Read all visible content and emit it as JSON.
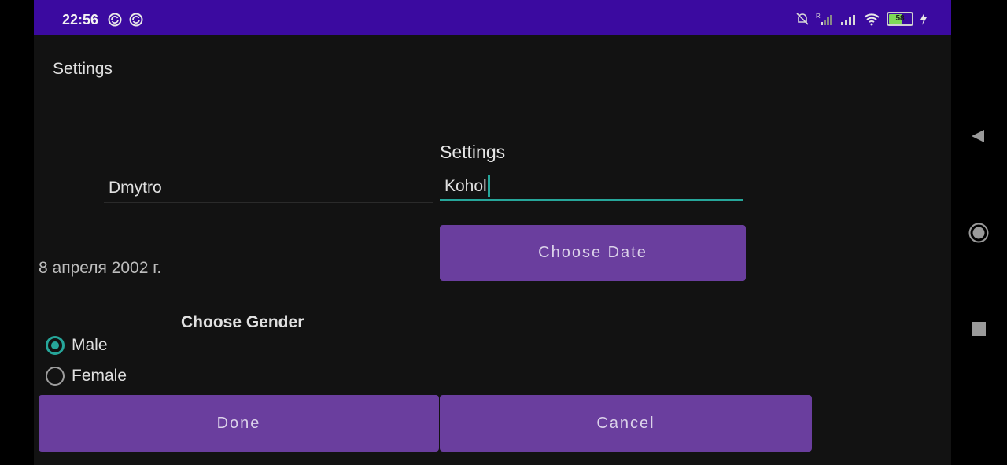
{
  "status_bar": {
    "time": "22:56",
    "battery_level": "58",
    "background_color": "#3b0aa0",
    "icons": [
      "sync-icon",
      "sync-icon",
      "mute-icon",
      "signal-roaming-icon",
      "signal-icon",
      "wifi-icon",
      "battery-icon",
      "charging-icon"
    ]
  },
  "app_bar": {
    "title": "Settings"
  },
  "form": {
    "section_title": "Settings",
    "first_name_value": "Dmytro",
    "last_name_value": "Kohol",
    "choose_date_label": "Choose Date",
    "date_value": "8 апреля 2002 г.",
    "gender_title": "Choose Gender",
    "gender_options": [
      {
        "label": "Male",
        "selected": true
      },
      {
        "label": "Female",
        "selected": false
      }
    ]
  },
  "actions": {
    "done_label": "Done",
    "cancel_label": "Cancel"
  },
  "nav_bar": {
    "icons": [
      "back-icon",
      "home-icon",
      "recents-icon"
    ]
  },
  "colors": {
    "accent": "#26a69a",
    "button": "#6a3e9e",
    "background": "#121212"
  }
}
